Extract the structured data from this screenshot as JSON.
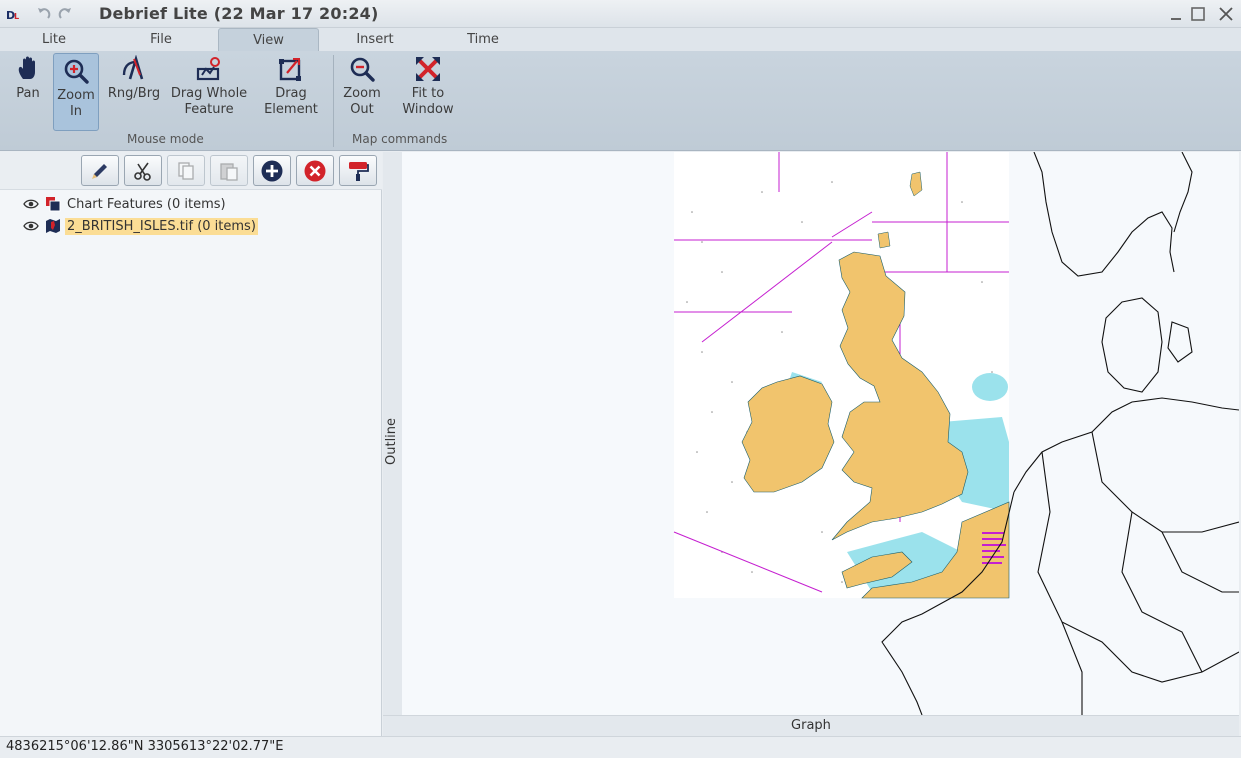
{
  "window": {
    "title": "Debrief Lite (22 Mar 17 20:24)"
  },
  "tabs": [
    {
      "label": "Lite"
    },
    {
      "label": "File"
    },
    {
      "label": "View"
    },
    {
      "label": "Insert"
    },
    {
      "label": "Time"
    }
  ],
  "active_tab": "View",
  "ribbon": {
    "mouse_mode": {
      "label": "Mouse mode",
      "buttons": [
        {
          "line1": "Pan",
          "line2": "",
          "icon": "hand-icon"
        },
        {
          "line1": "Zoom",
          "line2": "In",
          "icon": "zoom-in-icon",
          "selected": true
        },
        {
          "line1": "Rng/Brg",
          "line2": "",
          "icon": "range-bearing-icon"
        },
        {
          "line1": "Drag Whole",
          "line2": "Feature",
          "icon": "drag-feature-icon"
        },
        {
          "line1": "Drag",
          "line2": "Element",
          "icon": "drag-element-icon"
        }
      ]
    },
    "map_commands": {
      "label": "Map commands",
      "buttons": [
        {
          "line1": "Zoom",
          "line2": "Out",
          "icon": "zoom-out-icon"
        },
        {
          "line1": "Fit to",
          "line2": "Window",
          "icon": "fit-window-icon"
        }
      ]
    }
  },
  "outline": {
    "panel_label": "Outline",
    "toolbar": [
      {
        "name": "edit",
        "icon": "pencil-icon"
      },
      {
        "name": "cut",
        "icon": "scissors-icon"
      },
      {
        "name": "copy",
        "icon": "copy-icon"
      },
      {
        "name": "paste",
        "icon": "paste-icon"
      },
      {
        "name": "add",
        "icon": "add-icon"
      },
      {
        "name": "delete",
        "icon": "delete-icon"
      },
      {
        "name": "paint",
        "icon": "paint-roller-icon"
      }
    ],
    "items": [
      {
        "label": "Chart Features (0 items)",
        "icon": "layers-icon",
        "visible": true,
        "selected": false
      },
      {
        "label": "2_BRITISH_ISLES.tif (0 items)",
        "icon": "map-tile-icon",
        "visible": true,
        "selected": true
      }
    ]
  },
  "map": {
    "panel_label": "Graph"
  },
  "status": {
    "coordinates": "4836215°06'12.86\"N 3305613°22'02.77\"E"
  },
  "colors": {
    "land": "#f1c46d",
    "shallow_water": "#9be2ec",
    "chart_magenta": "#c51fd0",
    "selection": "#fbdd95"
  }
}
